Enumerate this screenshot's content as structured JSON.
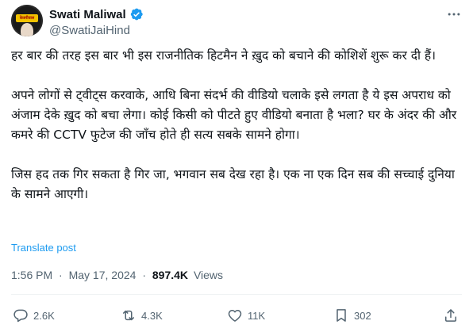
{
  "author": {
    "name": "Swati Maliwal",
    "handle": "@SwatiJaiHind",
    "avatar_badge_text": "केजरीवाल"
  },
  "tweet": {
    "paragraphs": [
      "हर बार की तरह इस बार भी इस राजनीतिक हिटमैन ने ख़ुद को बचाने की कोशिशें शुरू कर दी हैं।",
      "अपने लोगों से ट्वीट्स करवाके, आधि बिना संदर्भ की वीडियो चलाके इसे लगता है ये इस अपराध को अंजाम देके ख़ुद को बचा लेगा। कोई किसी को पीटते हुए वीडियो बनाता है भला? घर के अंदर की और कमरे की CCTV फुटेज की जाँच होते ही सत्य सबके सामने होगा।",
      "जिस हद तक गिर सकता है गिर जा, भगवान सब देख रहा है। एक ना एक दिन सब की सच्चाई दुनिया के सामने आएगी।"
    ],
    "translate_label": "Translate post",
    "time": "1:56 PM",
    "date": "May 17, 2024",
    "separator": "·",
    "views_count": "897.4K",
    "views_label": "Views"
  },
  "actions": {
    "reply_count": "2.6K",
    "repost_count": "4.3K",
    "like_count": "11K",
    "bookmark_count": "302"
  },
  "colors": {
    "text": "#0f1419",
    "secondary": "#536471",
    "link": "#1d9bf0",
    "verified": "#1d9bf0"
  },
  "icons": [
    "verified-badge-icon",
    "more-icon",
    "reply-icon",
    "repost-icon",
    "like-icon",
    "bookmark-icon",
    "share-icon"
  ]
}
